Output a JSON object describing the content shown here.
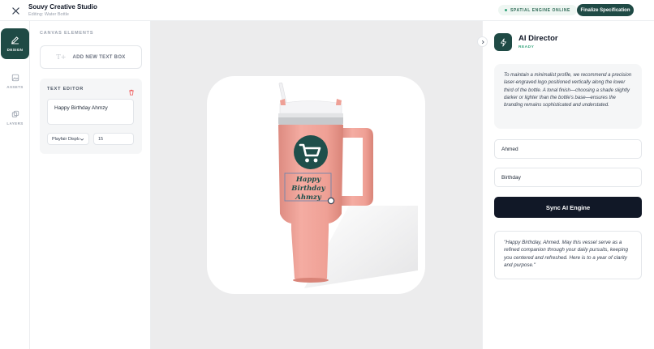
{
  "header": {
    "title": "Souvy Creative Studio",
    "subtitle": "Editing: Water Bottle",
    "engine_status": "SPATIAL ENGINE ONLINE",
    "finalize_label": "Finalize Specification"
  },
  "nav": {
    "items": [
      {
        "label": "DESIGN",
        "icon": "edit-icon",
        "active": true
      },
      {
        "label": "ASSETS",
        "icon": "image-icon",
        "active": false
      },
      {
        "label": "LAYERS",
        "icon": "layers-icon",
        "active": false
      }
    ]
  },
  "elements_panel": {
    "heading": "CANVAS ELEMENTS",
    "add_text_box": "ADD NEW TEXT BOX",
    "editor": {
      "title": "TEXT EDITOR",
      "text_value": "Happy Birthday Ahmzy",
      "font_value": "Playfair Display",
      "size_value": "15"
    }
  },
  "canvas": {
    "engraving_lines": [
      "Happy",
      "Birthday",
      "Ahmzy"
    ],
    "colors": {
      "bottle": "#eea096",
      "lid": "#f2f2f4",
      "logo": "#1f4f4b"
    }
  },
  "ai_panel": {
    "title": "AI Director",
    "status": "READY",
    "advice": "To maintain a minimalist profile, we recommend a precision laser-engraved logo positioned vertically along the lower third of the bottle. A tonal finish—choosing a shade slightly darker or lighter than the bottle's base—ensures the branding remains sophisticated and understated.",
    "name_value": "Ahmed",
    "occasion_value": "Birthday",
    "sync_label": "Sync AI Engine",
    "quote": "\"Happy Birthday, Ahmed. May this vessel serve as a refined companion through your daily pursuits, keeping you centered and refreshed. Here is to a year of clarity and purpose.\""
  }
}
